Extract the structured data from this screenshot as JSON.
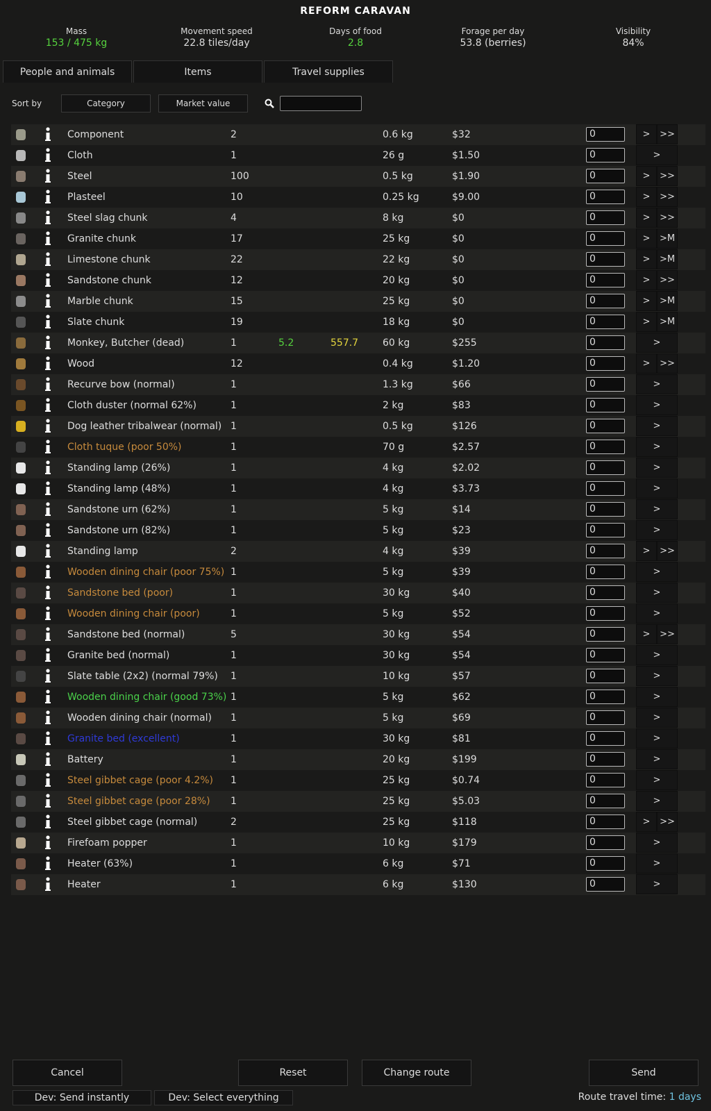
{
  "title": "REFORM CARAVAN",
  "stats": [
    {
      "label": "Mass",
      "value": "153 / 475 kg",
      "color": "green"
    },
    {
      "label": "Movement speed",
      "value": "22.8 tiles/day",
      "color": ""
    },
    {
      "label": "Days of food",
      "value": "2.8",
      "color": "green"
    },
    {
      "label": "Forage per day",
      "value": "53.8 (berries)",
      "color": ""
    },
    {
      "label": "Visibility",
      "value": "84%",
      "color": ""
    }
  ],
  "tabs": [
    "People and animals",
    "Items",
    "Travel supplies"
  ],
  "sort": {
    "label": "Sort by",
    "primary": "Category",
    "secondary": "Market value"
  },
  "search": {
    "value": ""
  },
  "colors": {
    "normal": "#dddddd",
    "poor": "#c68a3c",
    "good": "#4ad14a",
    "excellent": "#2f3ad8",
    "green": "#56d33e",
    "yellow": "#e3d43d"
  },
  "rows": [
    {
      "name": "Component",
      "count": "2",
      "a": "",
      "b": "",
      "mass": "0.6 kg",
      "value": "$32",
      "qty": "0",
      "btns": [
        ">",
        ">>"
      ],
      "quality": "normal",
      "icon": "component-icon"
    },
    {
      "name": "Cloth",
      "count": "1",
      "a": "",
      "b": "",
      "mass": "26 g",
      "value": "$1.50",
      "qty": "0",
      "btns": [
        ">"
      ],
      "quality": "normal",
      "icon": "cloth-icon"
    },
    {
      "name": "Steel",
      "count": "100",
      "a": "",
      "b": "",
      "mass": "0.5 kg",
      "value": "$1.90",
      "qty": "0",
      "btns": [
        ">",
        ">>"
      ],
      "quality": "normal",
      "icon": "steel-icon"
    },
    {
      "name": "Plasteel",
      "count": "10",
      "a": "",
      "b": "",
      "mass": "0.25 kg",
      "value": "$9.00",
      "qty": "0",
      "btns": [
        ">",
        ">>"
      ],
      "quality": "normal",
      "icon": "plasteel-icon"
    },
    {
      "name": "Steel slag chunk",
      "count": "4",
      "a": "",
      "b": "",
      "mass": "8 kg",
      "value": "$0",
      "qty": "0",
      "btns": [
        ">",
        ">>"
      ],
      "quality": "normal",
      "icon": "slag-chunk-icon"
    },
    {
      "name": "Granite chunk",
      "count": "17",
      "a": "",
      "b": "",
      "mass": "25 kg",
      "value": "$0",
      "qty": "0",
      "btns": [
        ">",
        ">M"
      ],
      "quality": "normal",
      "icon": "granite-chunk-icon"
    },
    {
      "name": "Limestone chunk",
      "count": "22",
      "a": "",
      "b": "",
      "mass": "22 kg",
      "value": "$0",
      "qty": "0",
      "btns": [
        ">",
        ">M"
      ],
      "quality": "normal",
      "icon": "limestone-chunk-icon"
    },
    {
      "name": "Sandstone chunk",
      "count": "12",
      "a": "",
      "b": "",
      "mass": "20 kg",
      "value": "$0",
      "qty": "0",
      "btns": [
        ">",
        ">>"
      ],
      "quality": "normal",
      "icon": "sandstone-chunk-icon"
    },
    {
      "name": "Marble chunk",
      "count": "15",
      "a": "",
      "b": "",
      "mass": "25 kg",
      "value": "$0",
      "qty": "0",
      "btns": [
        ">",
        ">M"
      ],
      "quality": "normal",
      "icon": "marble-chunk-icon"
    },
    {
      "name": "Slate chunk",
      "count": "19",
      "a": "",
      "b": "",
      "mass": "18 kg",
      "value": "$0",
      "qty": "0",
      "btns": [
        ">",
        ">M"
      ],
      "quality": "normal",
      "icon": "slate-chunk-icon"
    },
    {
      "name": "Monkey, Butcher (dead)",
      "count": "1",
      "a": "5.2",
      "b": "557.7",
      "mass": "60 kg",
      "value": "$255",
      "qty": "0",
      "btns": [
        ">"
      ],
      "quality": "normal",
      "icon": "corpse-icon"
    },
    {
      "name": "Wood",
      "count": "12",
      "a": "",
      "b": "",
      "mass": "0.4 kg",
      "value": "$1.20",
      "qty": "0",
      "btns": [
        ">",
        ">>"
      ],
      "quality": "normal",
      "icon": "wood-icon"
    },
    {
      "name": "Recurve bow (normal)",
      "count": "1",
      "a": "",
      "b": "",
      "mass": "1.3 kg",
      "value": "$66",
      "qty": "0",
      "btns": [
        ">"
      ],
      "quality": "normal",
      "icon": "bow-icon"
    },
    {
      "name": "Cloth duster (normal 62%)",
      "count": "1",
      "a": "",
      "b": "",
      "mass": "2 kg",
      "value": "$83",
      "qty": "0",
      "btns": [
        ">"
      ],
      "quality": "normal",
      "icon": "duster-icon"
    },
    {
      "name": "Dog leather tribalwear (normal)",
      "count": "1",
      "a": "",
      "b": "",
      "mass": "0.5 kg",
      "value": "$126",
      "qty": "0",
      "btns": [
        ">"
      ],
      "quality": "normal",
      "icon": "tribalwear-icon"
    },
    {
      "name": "Cloth tuque (poor 50%)",
      "count": "1",
      "a": "",
      "b": "",
      "mass": "70 g",
      "value": "$2.57",
      "qty": "0",
      "btns": [
        ">"
      ],
      "quality": "poor",
      "icon": "tuque-icon"
    },
    {
      "name": "Standing lamp (26%)",
      "count": "1",
      "a": "",
      "b": "",
      "mass": "4 kg",
      "value": "$2.02",
      "qty": "0",
      "btns": [
        ">"
      ],
      "quality": "normal",
      "icon": "lamp-icon"
    },
    {
      "name": "Standing lamp (48%)",
      "count": "1",
      "a": "",
      "b": "",
      "mass": "4 kg",
      "value": "$3.73",
      "qty": "0",
      "btns": [
        ">"
      ],
      "quality": "normal",
      "icon": "lamp-icon"
    },
    {
      "name": "Sandstone urn (62%)",
      "count": "1",
      "a": "",
      "b": "",
      "mass": "5 kg",
      "value": "$14",
      "qty": "0",
      "btns": [
        ">"
      ],
      "quality": "normal",
      "icon": "urn-icon"
    },
    {
      "name": "Sandstone urn (82%)",
      "count": "1",
      "a": "",
      "b": "",
      "mass": "5 kg",
      "value": "$23",
      "qty": "0",
      "btns": [
        ">"
      ],
      "quality": "normal",
      "icon": "urn-icon"
    },
    {
      "name": "Standing lamp",
      "count": "2",
      "a": "",
      "b": "",
      "mass": "4 kg",
      "value": "$39",
      "qty": "0",
      "btns": [
        ">",
        ">>"
      ],
      "quality": "normal",
      "icon": "lamp-icon"
    },
    {
      "name": "Wooden dining chair (poor 75%)",
      "count": "1",
      "a": "",
      "b": "",
      "mass": "5 kg",
      "value": "$39",
      "qty": "0",
      "btns": [
        ">"
      ],
      "quality": "poor",
      "icon": "chair-icon"
    },
    {
      "name": "Sandstone bed (poor)",
      "count": "1",
      "a": "",
      "b": "",
      "mass": "30 kg",
      "value": "$40",
      "qty": "0",
      "btns": [
        ">"
      ],
      "quality": "poor",
      "icon": "bed-icon"
    },
    {
      "name": "Wooden dining chair (poor)",
      "count": "1",
      "a": "",
      "b": "",
      "mass": "5 kg",
      "value": "$52",
      "qty": "0",
      "btns": [
        ">"
      ],
      "quality": "poor",
      "icon": "chair-icon"
    },
    {
      "name": "Sandstone bed (normal)",
      "count": "5",
      "a": "",
      "b": "",
      "mass": "30 kg",
      "value": "$54",
      "qty": "0",
      "btns": [
        ">",
        ">>"
      ],
      "quality": "normal",
      "icon": "bed-icon"
    },
    {
      "name": "Granite bed (normal)",
      "count": "1",
      "a": "",
      "b": "",
      "mass": "30 kg",
      "value": "$54",
      "qty": "0",
      "btns": [
        ">"
      ],
      "quality": "normal",
      "icon": "bed-icon"
    },
    {
      "name": "Slate table (2x2) (normal 79%)",
      "count": "1",
      "a": "",
      "b": "",
      "mass": "10 kg",
      "value": "$57",
      "qty": "0",
      "btns": [
        ">"
      ],
      "quality": "normal",
      "icon": "table-icon"
    },
    {
      "name": "Wooden dining chair (good 73%)",
      "count": "1",
      "a": "",
      "b": "",
      "mass": "5 kg",
      "value": "$62",
      "qty": "0",
      "btns": [
        ">"
      ],
      "quality": "good",
      "icon": "chair-icon"
    },
    {
      "name": "Wooden dining chair (normal)",
      "count": "1",
      "a": "",
      "b": "",
      "mass": "5 kg",
      "value": "$69",
      "qty": "0",
      "btns": [
        ">"
      ],
      "quality": "normal",
      "icon": "chair-icon"
    },
    {
      "name": "Granite bed (excellent)",
      "count": "1",
      "a": "",
      "b": "",
      "mass": "30 kg",
      "value": "$81",
      "qty": "0",
      "btns": [
        ">"
      ],
      "quality": "excellent",
      "icon": "bed-icon"
    },
    {
      "name": "Battery",
      "count": "1",
      "a": "",
      "b": "",
      "mass": "20 kg",
      "value": "$199",
      "qty": "0",
      "btns": [
        ">"
      ],
      "quality": "normal",
      "icon": "battery-icon"
    },
    {
      "name": "Steel gibbet cage (poor 4.2%)",
      "count": "1",
      "a": "",
      "b": "",
      "mass": "25 kg",
      "value": "$0.74",
      "qty": "0",
      "btns": [
        ">"
      ],
      "quality": "poor",
      "icon": "cage-icon"
    },
    {
      "name": "Steel gibbet cage (poor 28%)",
      "count": "1",
      "a": "",
      "b": "",
      "mass": "25 kg",
      "value": "$5.03",
      "qty": "0",
      "btns": [
        ">"
      ],
      "quality": "poor",
      "icon": "cage-icon"
    },
    {
      "name": "Steel gibbet cage (normal)",
      "count": "2",
      "a": "",
      "b": "",
      "mass": "25 kg",
      "value": "$118",
      "qty": "0",
      "btns": [
        ">",
        ">>"
      ],
      "quality": "normal",
      "icon": "cage-icon"
    },
    {
      "name": "Firefoam popper",
      "count": "1",
      "a": "",
      "b": "",
      "mass": "10 kg",
      "value": "$179",
      "qty": "0",
      "btns": [
        ">"
      ],
      "quality": "normal",
      "icon": "popper-icon"
    },
    {
      "name": "Heater (63%)",
      "count": "1",
      "a": "",
      "b": "",
      "mass": "6 kg",
      "value": "$71",
      "qty": "0",
      "btns": [
        ">"
      ],
      "quality": "normal",
      "icon": "heater-icon"
    },
    {
      "name": "Heater",
      "count": "1",
      "a": "",
      "b": "",
      "mass": "6 kg",
      "value": "$130",
      "qty": "0",
      "btns": [
        ">"
      ],
      "quality": "normal",
      "icon": "heater-icon"
    }
  ],
  "buttons": {
    "cancel": "Cancel",
    "reset": "Reset",
    "change_route": "Change route",
    "send": "Send"
  },
  "dev": {
    "send_instantly": "Dev: Send instantly",
    "select_everything": "Dev: Select everything"
  },
  "route": {
    "label": "Route travel time:",
    "days": "1 days"
  }
}
